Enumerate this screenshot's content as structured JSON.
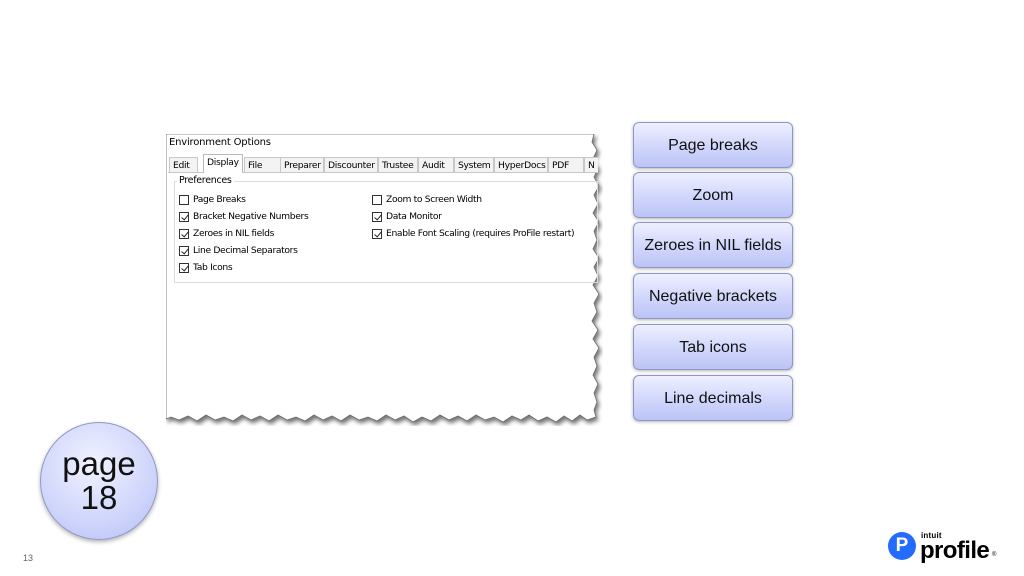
{
  "dialog": {
    "title": "Environment Options",
    "tabs": [
      "Edit",
      "Display",
      "File",
      "Preparer",
      "Discounter",
      "Trustee",
      "Audit",
      "System",
      "HyperDocs",
      "PDF",
      "N"
    ],
    "active_tab": "Display",
    "group_label": "Preferences",
    "options_left": [
      {
        "label": "Page Breaks",
        "checked": false
      },
      {
        "label": "Bracket Negative Numbers",
        "checked": true
      },
      {
        "label": "Zeroes in NIL fields",
        "checked": true
      },
      {
        "label": "Line Decimal Separators",
        "checked": true
      },
      {
        "label": "Tab Icons",
        "checked": true
      }
    ],
    "options_right": [
      {
        "label": "Zoom to Screen Width",
        "checked": false
      },
      {
        "label": "Data Monitor",
        "checked": true
      },
      {
        "label": "Enable Font Scaling (requires ProFile restart)",
        "checked": true
      }
    ]
  },
  "callouts": [
    "Page breaks",
    "Zoom",
    "Zeroes in NIL fields",
    "Negative brackets",
    "Tab icons",
    "Line decimals"
  ],
  "page_badge": {
    "line1": "page",
    "line2": "18"
  },
  "slide_number": "13",
  "logo": {
    "small": "intuit",
    "main": "profile",
    "reg": "®",
    "icon_letter": "P"
  },
  "colors": {
    "callout_fill": "#cfd5fb",
    "callout_border": "#8e98c6",
    "logo_blue": "#236cff"
  }
}
